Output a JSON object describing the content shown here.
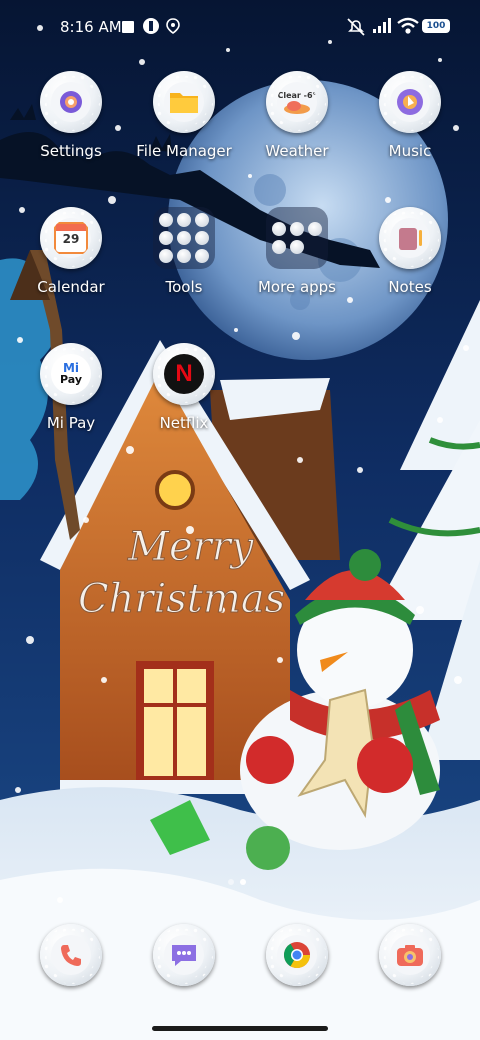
{
  "status_bar": {
    "time": "8:16 AM",
    "battery": "100",
    "icons": [
      "square-icon",
      "media-icon",
      "location-icon",
      "mute-icon",
      "signal-icon",
      "wifi-icon",
      "battery-icon"
    ]
  },
  "apps": [
    {
      "label": "Settings",
      "icon": "gear-icon"
    },
    {
      "label": "File Manager",
      "icon": "folder-icon"
    },
    {
      "label": "Weather",
      "icon": "weather-icon",
      "badge": "Clear -6°"
    },
    {
      "label": "Music",
      "icon": "music-icon"
    },
    {
      "label": "Calendar",
      "icon": "calendar-icon",
      "badge": "29"
    },
    {
      "label": "Tools",
      "icon": "folder-icon"
    },
    {
      "label": "More apps",
      "icon": "folder-icon"
    },
    {
      "label": "Notes",
      "icon": "notes-icon"
    },
    {
      "label": "Mi Pay",
      "icon": "mi-pay-icon",
      "badge_top": "Mi",
      "badge_bottom": "Pay"
    },
    {
      "label": "Netflix",
      "icon": "netflix-icon",
      "badge": "N"
    }
  ],
  "dock": [
    {
      "icon": "phone-icon"
    },
    {
      "icon": "messages-icon"
    },
    {
      "icon": "chrome-icon"
    },
    {
      "icon": "camera-icon"
    }
  ],
  "wallpaper": {
    "greeting_line1": "Merry",
    "greeting_line2": "Christmas"
  },
  "colors": {
    "sky": "#0b1f45",
    "snow": "#eaf2fa",
    "house": "#c36a2e",
    "accent_red": "#d32f2f"
  }
}
